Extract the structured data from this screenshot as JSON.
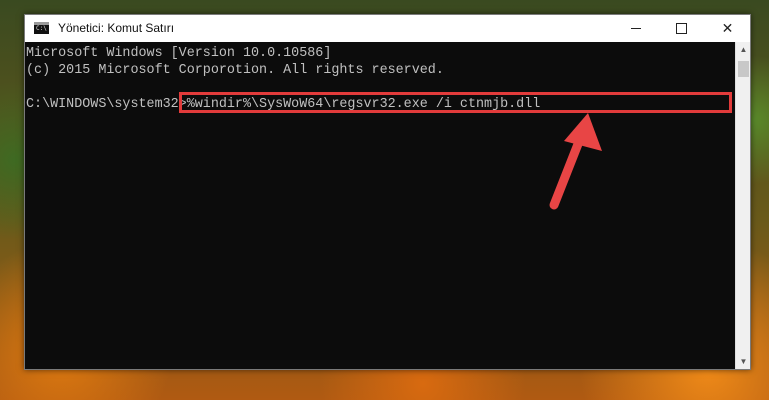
{
  "window": {
    "title": "Yönetici: Komut Satırı",
    "icon": "command-prompt-icon",
    "icon_label": "C:\\",
    "controls": {
      "minimize": "minimize-icon",
      "maximize": "maximize-icon",
      "close": "✕"
    }
  },
  "console": {
    "lines": [
      "Microsoft Windows [Version 10.0.10586]",
      "(c) 2015 Microsoft Corporotion. All rights reserved."
    ],
    "prompt": "C:\\WINDOWS\\system32>",
    "command": "%windir%\\SysWoW64\\regsvr32.exe /i ctnmjb.dll"
  },
  "annotation": {
    "highlight_color": "#e23b3b",
    "arrow_color": "#e84545"
  },
  "scrollbar": {
    "up": "▲",
    "down": "▼"
  }
}
